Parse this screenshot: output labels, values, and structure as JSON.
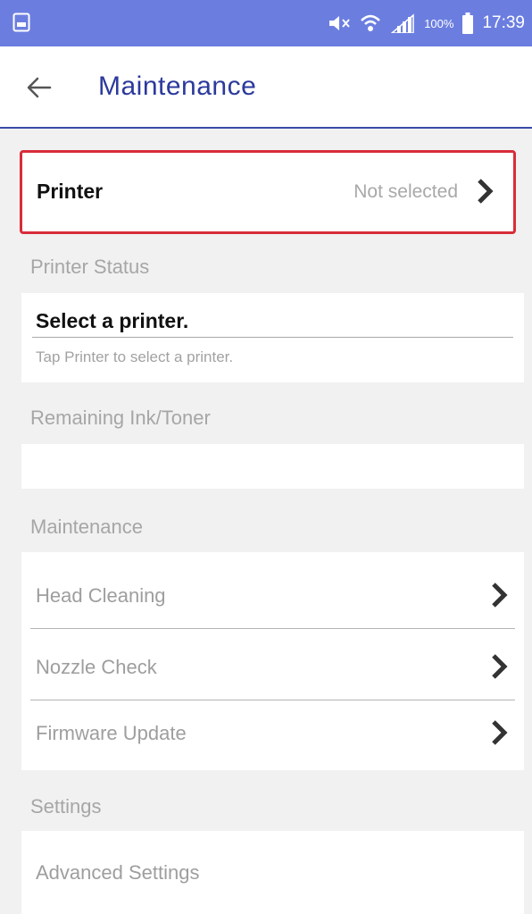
{
  "status_bar": {
    "battery_percent": "100%",
    "time": "17:39"
  },
  "header": {
    "title": "Maintenance"
  },
  "printer": {
    "label": "Printer",
    "value": "Not selected"
  },
  "printer_status": {
    "section_title": "Printer Status",
    "heading": "Select a printer.",
    "subtext": "Tap Printer to select a printer."
  },
  "ink": {
    "section_title": "Remaining Ink/Toner"
  },
  "maintenance": {
    "section_title": "Maintenance",
    "items": [
      {
        "label": "Head Cleaning"
      },
      {
        "label": "Nozzle Check"
      },
      {
        "label": "Firmware Update"
      }
    ]
  },
  "settings": {
    "section_title": "Settings",
    "items": [
      {
        "label": "Advanced Settings"
      }
    ]
  },
  "colors": {
    "status_bar": "#6b7ee0",
    "title": "#2b3a9c",
    "highlight_border": "#d82c3a"
  }
}
